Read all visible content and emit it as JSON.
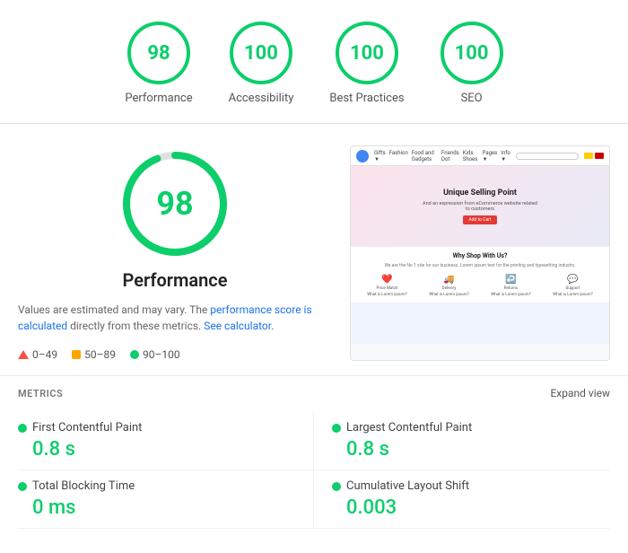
{
  "scores": [
    {
      "id": "performance",
      "label": "Performance",
      "value": "98"
    },
    {
      "id": "accessibility",
      "label": "Accessibility",
      "value": "100"
    },
    {
      "id": "best-practices",
      "label": "Best Practices",
      "value": "100"
    },
    {
      "id": "seo",
      "label": "SEO",
      "value": "100"
    }
  ],
  "main": {
    "big_score": "98",
    "big_label": "Performance",
    "description_text": "Values are estimated and may vary. The ",
    "link1": "performance score is calculated",
    "link1_middle": " directly from these metrics. ",
    "link2": "See calculator.",
    "legend": [
      {
        "id": "fail",
        "range": "0–49"
      },
      {
        "id": "average",
        "range": "50–89"
      },
      {
        "id": "pass",
        "range": "90–100"
      }
    ]
  },
  "mocksite": {
    "hero_title": "Unique Selling Point",
    "hero_sub": "And an expression from eCommerce website related to customers",
    "section_title": "Why Shop With Us?",
    "section_text": "We are the No 1 site for our business. Lorem ipsum text for the printing and typesetting industry.",
    "features": [
      {
        "icon": "❤",
        "label": "Price Match",
        "sub": "What is Lorem ipsum?"
      },
      {
        "icon": "🚚",
        "label": "Delivery",
        "sub": "What is Lorem ipsum?"
      },
      {
        "icon": "↩",
        "label": "Returns",
        "sub": "What is Lorem ipsum?"
      },
      {
        "icon": "💬",
        "label": "Support",
        "sub": "What is Lorem ipsum?"
      }
    ]
  },
  "metrics": {
    "title": "METRICS",
    "expand_label": "Expand view",
    "items": [
      {
        "id": "fcp",
        "label": "First Contentful Paint",
        "value": "0.8 s"
      },
      {
        "id": "lcp",
        "label": "Largest Contentful Paint",
        "value": "0.8 s"
      },
      {
        "id": "tbt",
        "label": "Total Blocking Time",
        "value": "0 ms"
      },
      {
        "id": "cls",
        "label": "Cumulative Layout Shift",
        "value": "0.003"
      }
    ]
  }
}
